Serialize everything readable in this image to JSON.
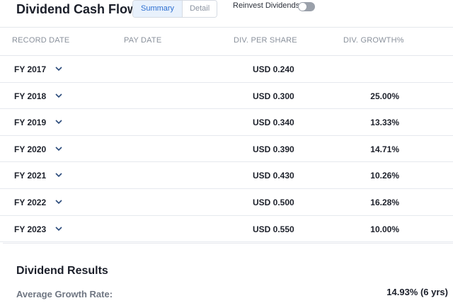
{
  "header": {
    "title": "Dividend Cash Flow",
    "view_tabs": [
      {
        "label": "Summary",
        "active": true
      },
      {
        "label": "Detail",
        "active": false
      }
    ],
    "reinvest_label": "Reinvest Dividends",
    "reinvest_enabled": false
  },
  "table": {
    "columns": [
      "RECORD DATE",
      "PAY DATE",
      "DIV. PER SHARE",
      "DIV. GROWTH%"
    ],
    "rows": [
      {
        "year": "FY 2017",
        "amount": "USD 0.240",
        "growth": ""
      },
      {
        "year": "FY 2018",
        "amount": "USD 0.300",
        "growth": "25.00%"
      },
      {
        "year": "FY 2019",
        "amount": "USD 0.340",
        "growth": "13.33%"
      },
      {
        "year": "FY 2020",
        "amount": "USD 0.390",
        "growth": "14.71%"
      },
      {
        "year": "FY 2021",
        "amount": "USD 0.430",
        "growth": "10.26%"
      },
      {
        "year": "FY 2022",
        "amount": "USD 0.500",
        "growth": "16.28%"
      },
      {
        "year": "FY 2023",
        "amount": "USD 0.550",
        "growth": "10.00%"
      }
    ]
  },
  "results": {
    "title": "Dividend Results",
    "avg_growth_label": "Average Growth Rate:",
    "avg_growth_value": "14.93% (6 yrs)"
  },
  "colors": {
    "accent": "#2d6fd1",
    "accent_bg": "#e8f1fc",
    "chevron": "#2a4a7a"
  }
}
